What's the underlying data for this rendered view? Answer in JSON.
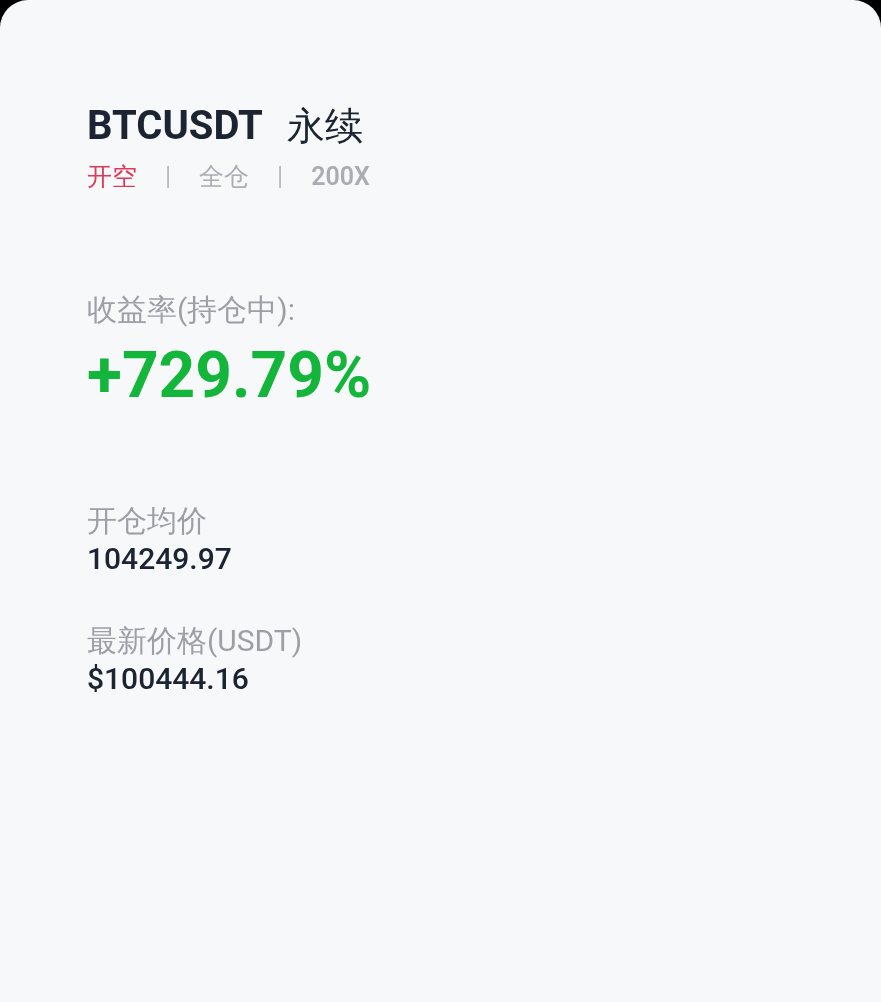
{
  "header": {
    "symbol": "BTCUSDT",
    "contract_type": "永续"
  },
  "position_tags": [
    {
      "kind": "side",
      "text": "开空"
    },
    {
      "kind": "separator",
      "text": "|"
    },
    {
      "kind": "margin",
      "text": "全仓"
    },
    {
      "kind": "separator",
      "text": "|"
    },
    {
      "kind": "leverage",
      "text": "200X"
    }
  ],
  "roi": {
    "label": "收益率(持仓中):",
    "value": "+729.79%"
  },
  "stats": [
    {
      "label": "开仓均价",
      "value": "104249.97"
    },
    {
      "label": "最新价格(USDT)",
      "value": "$100444.16"
    }
  ]
}
